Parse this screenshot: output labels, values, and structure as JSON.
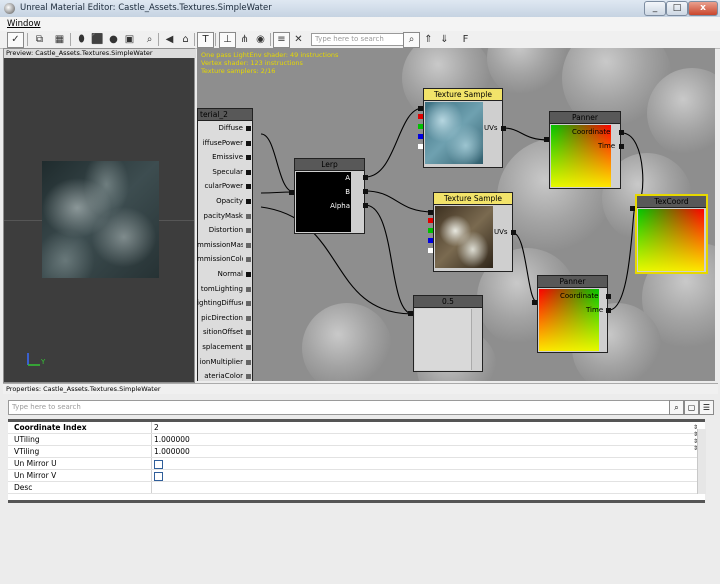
{
  "window": {
    "title": "Unreal Material Editor: Castle_Assets.Textures.SimpleWater",
    "min": "_",
    "max": "□",
    "close": "x"
  },
  "menu": {
    "window": "Window"
  },
  "toolbar": {
    "search_placeholder": "Type here to search"
  },
  "preview": {
    "title": "Preview: Castle_Assets.Textures.SimpleWater",
    "axis_y": "Y"
  },
  "graph": {
    "stats": [
      "One pass LightEnv shader: 49 instructions",
      "Vertex shader: 123 instructions",
      "Texture samplers: 2/16"
    ],
    "material_node": {
      "title": "terial_2",
      "pins": [
        "Diffuse",
        "iffusePower",
        "Emissive",
        "Specular",
        "cularPower",
        "Opacity",
        "pacityMask",
        "Distortion",
        "mmissionMask",
        "mmissionColor",
        "Normal",
        "tomLighting",
        "ightingDiffuse",
        "picDirection",
        "sitionOffset",
        "splacement",
        "ionMultiplier",
        "ateriaColor"
      ]
    },
    "lerp": {
      "title": "Lerp",
      "pins": [
        "A",
        "B",
        "Alpha"
      ]
    },
    "texture1": {
      "title": "Texture Sample",
      "output": "UVs"
    },
    "texture2": {
      "title": "Texture Sample",
      "output": "UVs"
    },
    "panner1": {
      "title": "Panner",
      "pins": [
        "Coordinate",
        "Time"
      ]
    },
    "panner2": {
      "title": "Panner",
      "pins": [
        "Coordinate",
        "Time"
      ]
    },
    "texcoord": {
      "title": "TexCoord"
    },
    "constant": {
      "title": "0.5"
    }
  },
  "properties": {
    "title": "Properties: Castle_Assets.Textures.SimpleWater",
    "search_placeholder": "Type here to search",
    "rows": [
      {
        "key": "Coordinate Index",
        "value": "2"
      },
      {
        "key": "UTiling",
        "value": "1.000000"
      },
      {
        "key": "VTiling",
        "value": "1.000000"
      },
      {
        "key": "Un Mirror U",
        "value": ""
      },
      {
        "key": "Un Mirror V",
        "value": ""
      },
      {
        "key": "Desc",
        "value": ""
      }
    ]
  },
  "colors": {
    "stats_text": "#e6d800",
    "node_selected_border": "#e6d800",
    "graph_background": "#8e8e8e"
  }
}
